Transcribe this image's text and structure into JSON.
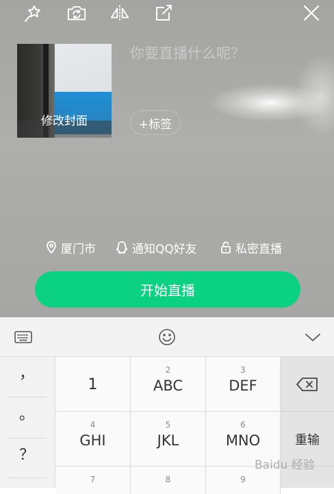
{
  "topbar": {
    "icons": [
      "beauty-wand-icon",
      "flip-camera-icon",
      "mirror-icon",
      "share-icon",
      "close-icon"
    ]
  },
  "cover": {
    "label": "修改封面"
  },
  "title": {
    "placeholder": "你要直播什么呢？"
  },
  "tag": {
    "label": "+标签"
  },
  "options": {
    "location": "厦门市",
    "notify": "通知QQ好友",
    "private": "私密直播"
  },
  "start_button": {
    "label": "开始直播",
    "color": "#0bd283"
  },
  "keyboard": {
    "symbols": [
      "，",
      "。",
      "？"
    ],
    "keys": [
      {
        "sub": "",
        "main": "1"
      },
      {
        "sub": "2",
        "main": "ABC"
      },
      {
        "sub": "3",
        "main": "DEF"
      },
      {
        "sub": "4",
        "main": "GHI"
      },
      {
        "sub": "5",
        "main": "JKL"
      },
      {
        "sub": "6",
        "main": "MNO"
      },
      {
        "sub": "7",
        "main": ""
      },
      {
        "sub": "8",
        "main": ""
      },
      {
        "sub": "9",
        "main": ""
      }
    ],
    "enter_label": "重输"
  },
  "watermark": "Baidu 经验"
}
